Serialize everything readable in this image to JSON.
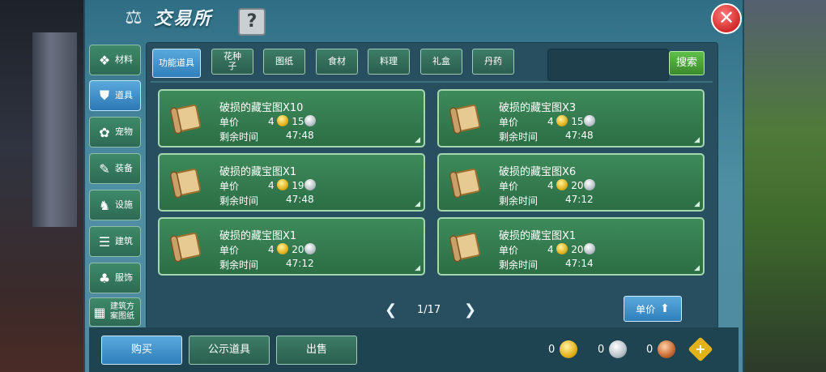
{
  "title": "交易所",
  "help_label": "?",
  "close_label": "✕",
  "sidebar": [
    {
      "label": "材料",
      "icon": "materials-icon",
      "glyph": "❖",
      "active": false
    },
    {
      "label": "道具",
      "icon": "item-icon",
      "glyph": "⛊",
      "active": true
    },
    {
      "label": "宠物",
      "icon": "pet-paw-icon",
      "glyph": "✿",
      "active": false
    },
    {
      "label": "装备",
      "icon": "equipment-icon",
      "glyph": "✎",
      "active": false
    },
    {
      "label": "设施",
      "icon": "facility-icon",
      "glyph": "♞",
      "active": false
    },
    {
      "label": "建筑",
      "icon": "building-icon",
      "glyph": "☰",
      "active": false
    },
    {
      "label": "服饰",
      "icon": "clothing-icon",
      "glyph": "♣",
      "active": false
    },
    {
      "label": "建筑方案图纸",
      "icon": "blueprint-icon",
      "glyph": "▦",
      "active": false
    }
  ],
  "tabs": [
    {
      "label": "功能道具",
      "active": true
    },
    {
      "label": "花种子",
      "active": false
    },
    {
      "label": "图纸",
      "active": false
    },
    {
      "label": "食材",
      "active": false
    },
    {
      "label": "料理",
      "active": false
    },
    {
      "label": "礼盒",
      "active": false
    },
    {
      "label": "丹药",
      "active": false
    }
  ],
  "search": {
    "placeholder": "",
    "button_label": "搜索"
  },
  "labels": {
    "price": "单价",
    "remaining": "剩余时间"
  },
  "items": [
    {
      "name": "破损的藏宝图X10",
      "gold": "4",
      "silver": "15",
      "time": "47:48"
    },
    {
      "name": "破损的藏宝图X3",
      "gold": "4",
      "silver": "15",
      "time": "47:48"
    },
    {
      "name": "破损的藏宝图X1",
      "gold": "4",
      "silver": "19",
      "time": "47:48"
    },
    {
      "name": "破损的藏宝图X6",
      "gold": "4",
      "silver": "20",
      "time": "47:12"
    },
    {
      "name": "破损的藏宝图X1",
      "gold": "4",
      "silver": "20",
      "time": "47:12"
    },
    {
      "name": "破损的藏宝图X1",
      "gold": "4",
      "silver": "20",
      "time": "47:14"
    }
  ],
  "pager": {
    "text": "1/17",
    "prev": "❮",
    "next": "❯"
  },
  "sort_label": "单价",
  "bottom": {
    "buy": "购买",
    "public": "公示道具",
    "sell": "出售"
  },
  "currency": {
    "gold": "0",
    "silver": "0",
    "copper": "0"
  },
  "colors": {
    "panel": "#4f8fa4",
    "item_bg": "#3d8a5a",
    "active_blue": "#2f7fbc",
    "search_green": "#3b8a2a",
    "close_red": "#d22a2a"
  }
}
